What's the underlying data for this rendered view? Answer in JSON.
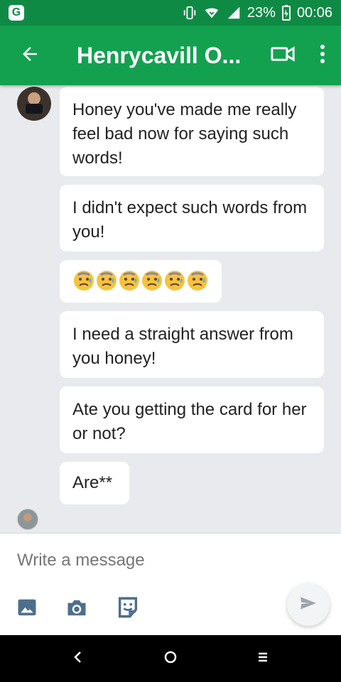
{
  "status_bar": {
    "battery": "23%",
    "time": "00:06"
  },
  "header": {
    "title": "Henrycavill O..."
  },
  "messages": [
    {
      "text": "Honey you've made me really feel bad now for saying such words!"
    },
    {
      "text": "I didn't expect such words from you!"
    },
    {
      "emoji_count": 6,
      "emoji": "worried-sweat-face"
    },
    {
      "text": "I need a straight answer from you honey!"
    },
    {
      "text": "Ate you getting the card for her or not?"
    },
    {
      "text": "Are**"
    }
  ],
  "composer": {
    "placeholder": "Write a message"
  },
  "icons": {
    "app_logo": "app-logo-icon",
    "vibrate": "vibrate-icon",
    "wifi": "wifi-icon",
    "signal": "signal-icon",
    "battery": "battery-charging-icon",
    "back": "arrow-left-icon",
    "video": "video-camera-icon",
    "more": "more-vert-icon",
    "image": "image-icon",
    "camera": "camera-icon",
    "sticker": "sticker-icon",
    "send": "send-icon"
  },
  "colors": {
    "status_bar": "#0f8a45",
    "app_bar": "#13a150",
    "chat_bg": "#e8eaed",
    "bubble": "#ffffff",
    "icon_blue": "#4e6f8b"
  }
}
